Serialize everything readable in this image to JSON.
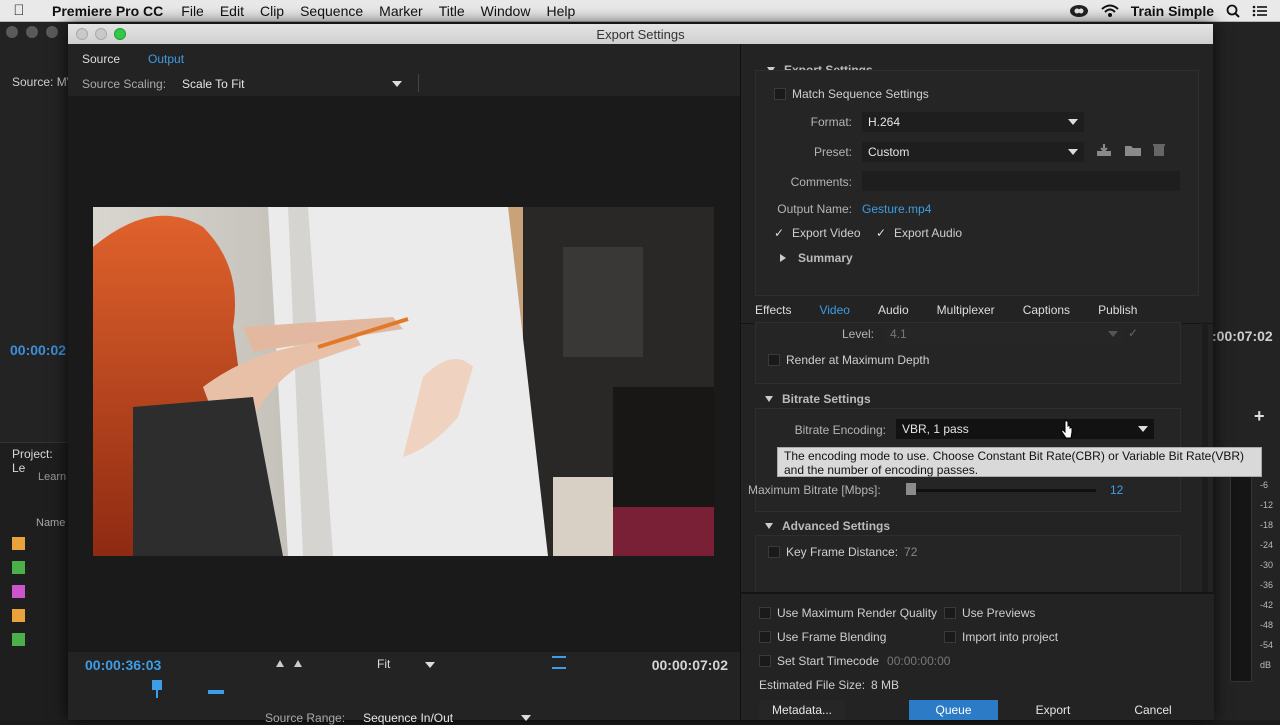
{
  "menubar": {
    "apple": "",
    "app_name": "Premiere Pro CC",
    "items": [
      "File",
      "Edit",
      "Clip",
      "Sequence",
      "Marker",
      "Title",
      "Window",
      "Help"
    ],
    "user": "Train Simple"
  },
  "background_app": {
    "source_label": "Source: MV",
    "timecode_left": "00:00:02",
    "timecode_right": ":00:07:02",
    "project_title": "Project: Le",
    "project_learn": "Learn",
    "project_name_col": "Name",
    "audio_levels": [
      "-6",
      "-12",
      "-18",
      "-24",
      "-30",
      "-36",
      "-42",
      "-48",
      "-54",
      "dB"
    ],
    "swatch_colors": [
      "#e8a33c",
      "#4cb04a",
      "#cc55cc",
      "#e8a33c",
      "#4cb04a"
    ]
  },
  "dialog": {
    "title": "Export Settings",
    "left": {
      "tabs": [
        "Source",
        "Output"
      ],
      "active_tab": "Output",
      "source_scaling_label": "Source Scaling:",
      "source_scaling_value": "Scale To Fit",
      "current_timecode": "00:00:36:03",
      "duration_timecode": "00:00:07:02",
      "zoom_value": "Fit",
      "source_range_label": "Source Range:",
      "source_range_value": "Sequence In/Out"
    },
    "right": {
      "export_settings_heading": "Export Settings",
      "match_sequence_label": "Match Sequence Settings",
      "format_label": "Format:",
      "format_value": "H.264",
      "preset_label": "Preset:",
      "preset_value": "Custom",
      "comments_label": "Comments:",
      "output_name_label": "Output Name:",
      "output_name_value": "Gesture.mp4",
      "export_video_label": "Export Video",
      "export_audio_label": "Export Audio",
      "summary_label": "Summary",
      "tabs": [
        "Effects",
        "Video",
        "Audio",
        "Multiplexer",
        "Captions",
        "Publish"
      ],
      "active_tab": "Video",
      "level_label": "Level:",
      "level_value": "4.1",
      "render_max_depth_label": "Render at Maximum Depth",
      "bitrate_heading": "Bitrate Settings",
      "bitrate_encoding_label": "Bitrate Encoding:",
      "bitrate_encoding_value": "VBR, 1 pass",
      "tooltip_text": "The encoding mode to use. Choose Constant Bit Rate(CBR) or Variable Bit Rate(VBR) and the number of encoding passes.",
      "max_bitrate_label": "Maximum Bitrate [Mbps]:",
      "max_bitrate_value": "12",
      "advanced_heading": "Advanced Settings",
      "key_frame_label": "Key Frame Distance:",
      "key_frame_value": "72",
      "use_max_render_quality": "Use Maximum Render Quality",
      "use_previews": "Use Previews",
      "use_frame_blending": "Use Frame Blending",
      "import_into_project": "Import into project",
      "set_start_timecode": "Set Start Timecode",
      "start_timecode_value": "00:00:00:00",
      "estimated_size_label": "Estimated File Size:",
      "estimated_size_value": "8 MB",
      "metadata_button": "Metadata...",
      "queue_button": "Queue",
      "export_button": "Export",
      "cancel_button": "Cancel"
    }
  },
  "colors": {
    "accent": "#3d9de6",
    "queue_button": "#2b7bc6"
  }
}
